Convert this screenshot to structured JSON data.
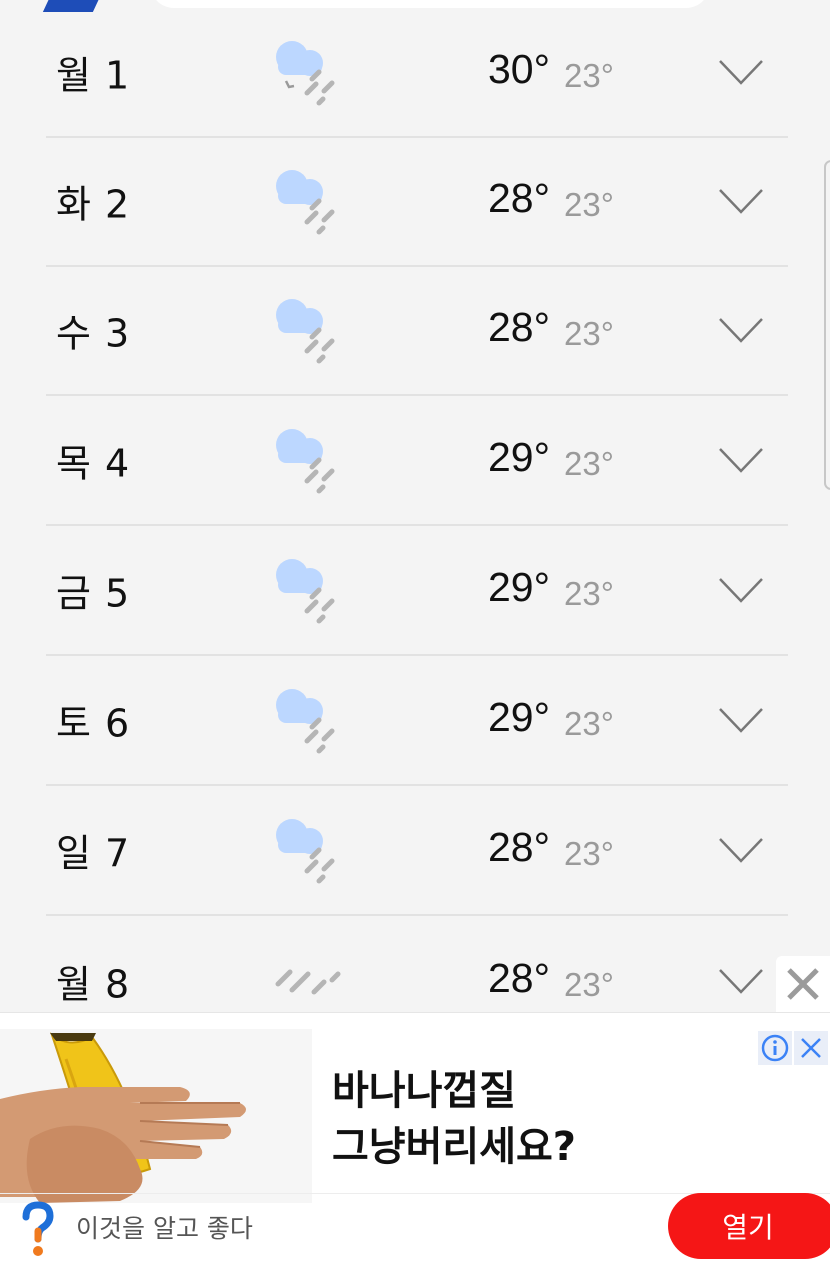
{
  "forecast": [
    {
      "day": "월 1",
      "hi": "30°",
      "lo": "23°",
      "icon": "cloud-rain-icon"
    },
    {
      "day": "화 2",
      "hi": "28°",
      "lo": "23°",
      "icon": "cloud-rain-icon"
    },
    {
      "day": "수 3",
      "hi": "28°",
      "lo": "23°",
      "icon": "cloud-rain-icon"
    },
    {
      "day": "목 4",
      "hi": "29°",
      "lo": "23°",
      "icon": "cloud-rain-icon"
    },
    {
      "day": "금 5",
      "hi": "29°",
      "lo": "23°",
      "icon": "cloud-rain-icon"
    },
    {
      "day": "토 6",
      "hi": "29°",
      "lo": "23°",
      "icon": "cloud-rain-icon"
    },
    {
      "day": "일 7",
      "hi": "28°",
      "lo": "23°",
      "icon": "cloud-rain-icon"
    },
    {
      "day": "월 8",
      "hi": "28°",
      "lo": "23°",
      "icon": "rain-icon"
    }
  ],
  "ad": {
    "headline_line1": "바나나껍질",
    "headline_line2": "그냥버리세요?",
    "subtitle": "이것을 알고 좋다",
    "open_label": "열기"
  },
  "colors": {
    "background": "#f4f4f4",
    "cloud": "#bcd7ff",
    "rain": "#b5b5b5",
    "ad_button": "#f51616",
    "ad_info_icon": "#3b82f6"
  }
}
